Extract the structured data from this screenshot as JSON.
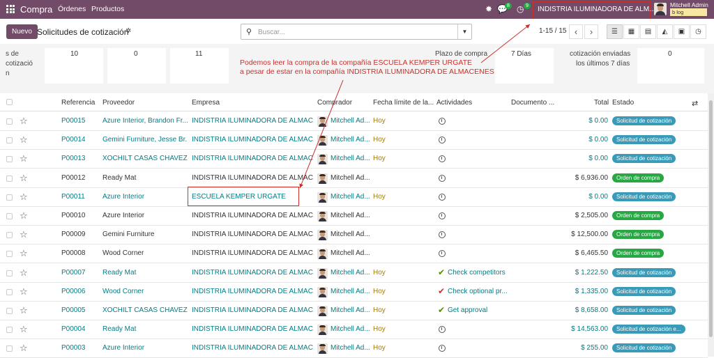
{
  "topbar": {
    "app_name": "Compra",
    "menus": [
      "Órdenes",
      "Productos"
    ],
    "chat_badge": "8",
    "activity_badge": "9",
    "company": "INDISTRIA ILUMINADORA DE ALM...",
    "user_name": "Mitchell Admin",
    "db_tag": "b log"
  },
  "control": {
    "new_label": "Nuevo",
    "title": "Solicitudes de cotización",
    "search_placeholder": "Buscar...",
    "pager": "1-15 / 15"
  },
  "dashboard": {
    "left_label": [
      "s de",
      "cotizació",
      "n"
    ],
    "values": [
      "10",
      "0",
      "11"
    ],
    "lead_label": "Plazo de compra",
    "lead_value": "7 Días",
    "sent_label_1": "cotización enviadas",
    "sent_label_2": "los últimos 7 días",
    "sent_value": "0"
  },
  "annotation": {
    "line1": "Podemos leer la compra de la compañía ESCUELA KEMPER URGATE",
    "line2": "a pesar de estar en la compañía INDISTRIA ILUMINADORA DE ALMACENES"
  },
  "columns": {
    "ref": "Referencia",
    "vendor": "Proveedor",
    "company": "Empresa",
    "buyer": "Comprador",
    "deadline": "Fecha límite de la...",
    "activities": "Actividades",
    "source": "Documento ...",
    "total": "Total",
    "status": "Estado"
  },
  "rows": [
    {
      "ref": "P00015",
      "vendor": "Azure Interior, Brandon Fr...",
      "company": "INDISTRIA ILUMINADORA DE ALMAC...",
      "buyer": "Mitchell Ad...",
      "deadline": "Hoy",
      "activity": "",
      "total": "$ 0.00",
      "status": "Solicitud de cotización"
    },
    {
      "ref": "P00014",
      "vendor": "Gemini Furniture, Jesse Br...",
      "company": "INDISTRIA ILUMINADORA DE ALMAC...",
      "buyer": "Mitchell Ad...",
      "deadline": "Hoy",
      "activity": "",
      "total": "$ 0.00",
      "status": "Solicitud de cotización"
    },
    {
      "ref": "P00013",
      "vendor": "XOCHILT CASAS CHAVEZ",
      "company": "INDISTRIA ILUMINADORA DE ALMAC...",
      "buyer": "Mitchell Ad...",
      "deadline": "Hoy",
      "activity": "",
      "total": "$ 0.00",
      "status": "Solicitud de cotización"
    },
    {
      "ref": "P00012",
      "vendor": "Ready Mat",
      "company": "INDISTRIA ILUMINADORA DE ALMAC...",
      "buyer": "Mitchell Ad...",
      "deadline": "",
      "activity": "",
      "total": "$ 6,936.00",
      "status": "Orden de compra"
    },
    {
      "ref": "P00011",
      "vendor": "Azure Interior",
      "company": "ESCUELA KEMPER URGATE",
      "buyer": "Mitchell Ad...",
      "deadline": "Hoy",
      "activity": "",
      "total": "$ 0.00",
      "status": "Solicitud de cotización"
    },
    {
      "ref": "P00010",
      "vendor": "Azure Interior",
      "company": "INDISTRIA ILUMINADORA DE ALMAC...",
      "buyer": "Mitchell Ad...",
      "deadline": "",
      "activity": "",
      "total": "$ 2,505.00",
      "status": "Orden de compra"
    },
    {
      "ref": "P00009",
      "vendor": "Gemini Furniture",
      "company": "INDISTRIA ILUMINADORA DE ALMAC...",
      "buyer": "Mitchell Ad...",
      "deadline": "",
      "activity": "",
      "total": "$ 12,500.00",
      "status": "Orden de compra"
    },
    {
      "ref": "P00008",
      "vendor": "Wood Corner",
      "company": "INDISTRIA ILUMINADORA DE ALMAC...",
      "buyer": "Mitchell Ad...",
      "deadline": "",
      "activity": "",
      "total": "$ 6,465.50",
      "status": "Orden de compra"
    },
    {
      "ref": "P00007",
      "vendor": "Ready Mat",
      "company": "INDISTRIA ILUMINADORA DE ALMAC...",
      "buyer": "Mitchell Ad...",
      "deadline": "Hoy",
      "activity": "Check competitors",
      "total": "$ 1,222.50",
      "status": "Solicitud de cotización"
    },
    {
      "ref": "P00006",
      "vendor": "Wood Corner",
      "company": "INDISTRIA ILUMINADORA DE ALMAC...",
      "buyer": "Mitchell Ad...",
      "deadline": "Hoy",
      "activity": "Check optional pr...",
      "total": "$ 1,335.00",
      "status": "Solicitud de cotización"
    },
    {
      "ref": "P00005",
      "vendor": "XOCHILT CASAS CHAVEZ",
      "company": "INDISTRIA ILUMINADORA DE ALMAC...",
      "buyer": "Mitchell Ad...",
      "deadline": "Hoy",
      "activity": "Get approval",
      "total": "$ 8,658.00",
      "status": "Solicitud de cotización"
    },
    {
      "ref": "P00004",
      "vendor": "Ready Mat",
      "company": "INDISTRIA ILUMINADORA DE ALMAC...",
      "buyer": "Mitchell Ad...",
      "deadline": "Hoy",
      "activity": "",
      "total": "$ 14,563.00",
      "status": "Solicitud de cotización e..."
    },
    {
      "ref": "P00003",
      "vendor": "Azure Interior",
      "company": "INDISTRIA ILUMINADORA DE ALMAC...",
      "buyer": "Mitchell Ad...",
      "deadline": "Hoy",
      "activity": "",
      "total": "$ 255.00",
      "status": "Solicitud de cotización"
    }
  ],
  "colors": {
    "brand": "#714B67",
    "link": "#017e84",
    "rfq_badge": "#3a9bb8",
    "po_badge": "#28a745",
    "annotation": "#c9302c"
  }
}
